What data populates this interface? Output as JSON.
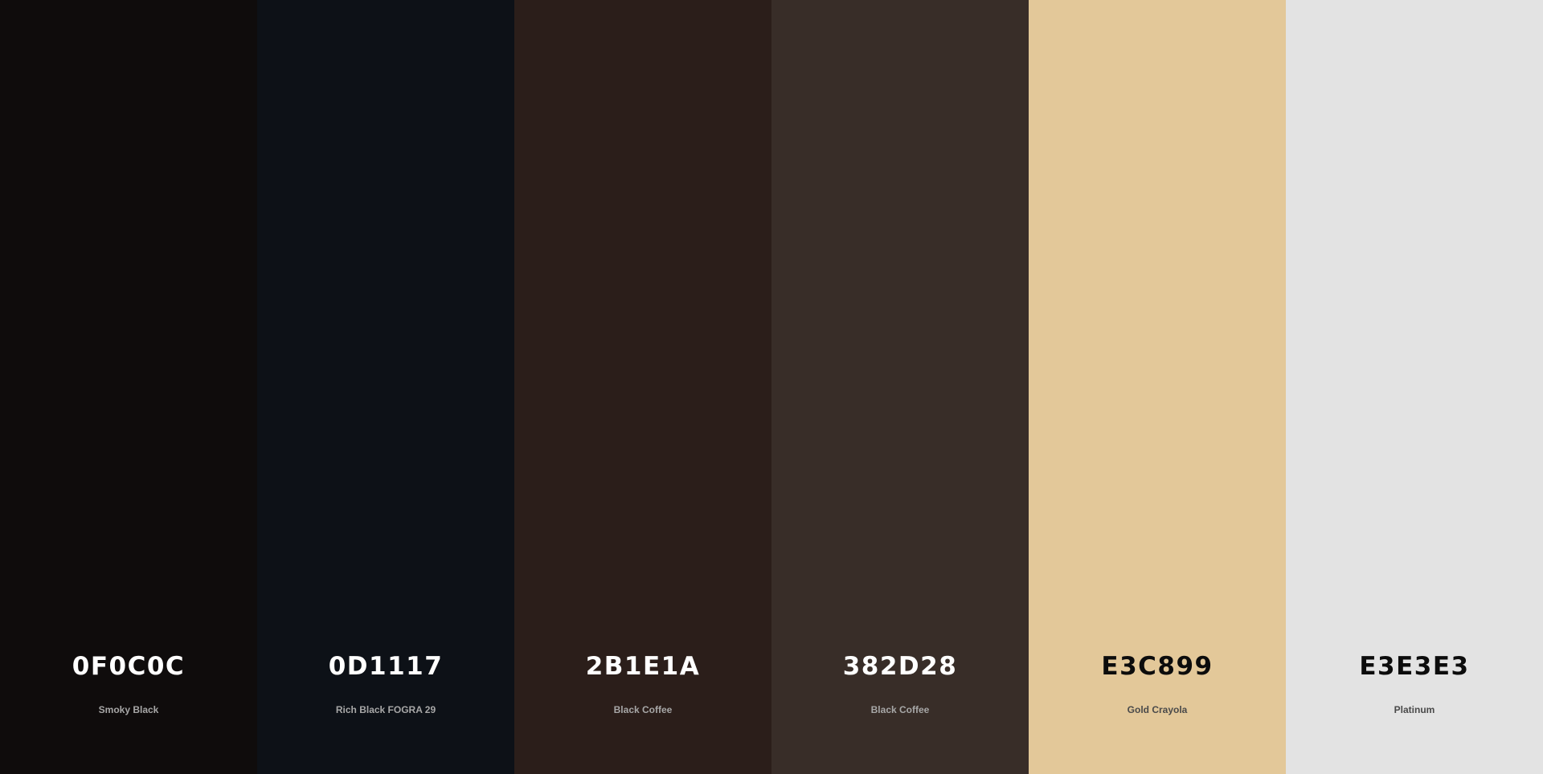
{
  "colors": [
    {
      "hex": "0F0C0C",
      "name": "Smoky Black",
      "color": "#0F0C0C",
      "theme": "dark"
    },
    {
      "hex": "0D1117",
      "name": "Rich Black FOGRA 29",
      "color": "#0D1117",
      "theme": "dark"
    },
    {
      "hex": "2B1E1A",
      "name": "Black Coffee",
      "color": "#2B1E1A",
      "theme": "dark"
    },
    {
      "hex": "382D28",
      "name": "Black Coffee",
      "color": "#382D28",
      "theme": "dark"
    },
    {
      "hex": "E3C899",
      "name": "Gold Crayola",
      "color": "#E3C899",
      "theme": "light"
    },
    {
      "hex": "E3E3E3",
      "name": "Platinum",
      "color": "#E3E3E3",
      "theme": "light"
    }
  ]
}
